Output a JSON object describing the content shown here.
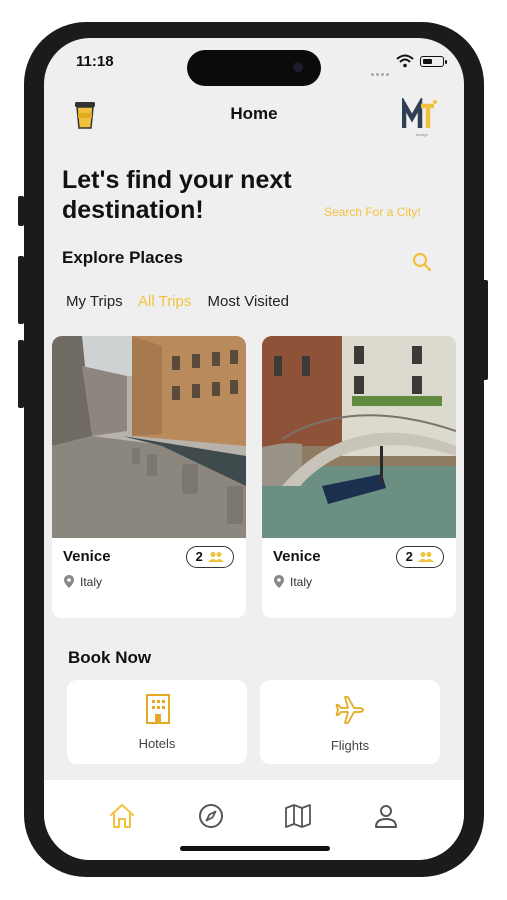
{
  "status": {
    "time": "11:18"
  },
  "header": {
    "title": "Home",
    "cup_icon": "cup-icon",
    "logo_text": "MT",
    "logo_sub": "design"
  },
  "hero": {
    "line1": "Let's find your next",
    "line2": "destination!",
    "search_link": "Search For a City!"
  },
  "explore": {
    "title": "Explore Places"
  },
  "tabs": [
    {
      "label": "My Trips",
      "active": false
    },
    {
      "label": "All Trips",
      "active": true
    },
    {
      "label": "Most Visited",
      "active": false
    }
  ],
  "cards": [
    {
      "name": "Venice",
      "country": "Italy",
      "people": "2"
    },
    {
      "name": "Venice",
      "country": "Italy",
      "people": "2"
    }
  ],
  "book_now": {
    "title": "Book Now",
    "hotels": "Hotels",
    "flights": "Flights"
  },
  "colors": {
    "accent": "#f2c23e",
    "background": "#efefef",
    "card": "#ffffff"
  },
  "nav": [
    "home-icon",
    "compass-icon",
    "map-icon",
    "profile-icon"
  ]
}
